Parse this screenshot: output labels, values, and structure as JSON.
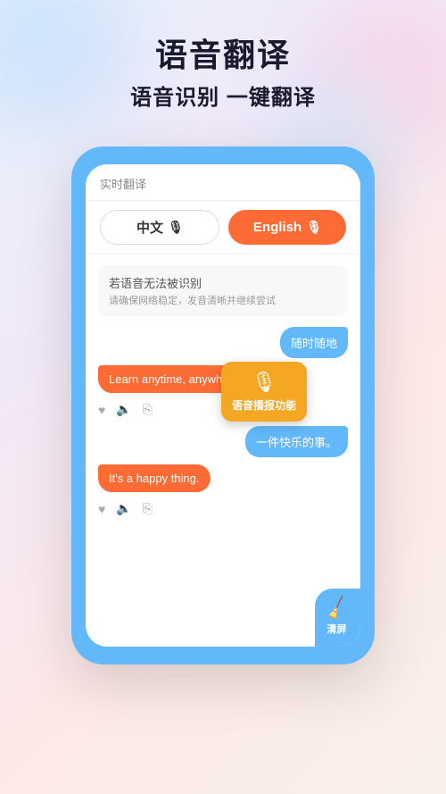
{
  "background": {
    "gradient": "linear-gradient(135deg, #e8f4fd, #f0e8f8, #fde8e8, #f8f0e8)"
  },
  "header": {
    "main_title": "语音翻译",
    "sub_title": "语音识别 一键翻译"
  },
  "phone": {
    "top_bar_label": "实时翻译",
    "lang_left": {
      "label": "中文",
      "mic": "🎤"
    },
    "lang_right": {
      "label": "English",
      "mic": "🎤"
    },
    "recognition_fail": {
      "title": "若语音无法被识别",
      "desc": "请确保网络稳定，发音清晰并继续尝试"
    },
    "chat": [
      {
        "type": "right",
        "text": "随时随地"
      },
      {
        "type": "left_red",
        "text": "Learn anytime, anywhere."
      },
      {
        "type": "right",
        "text": "一件快乐的事。"
      },
      {
        "type": "left_red",
        "text": "It's a happy thing."
      }
    ],
    "tooltip": {
      "text": "语音播报功能"
    },
    "clear_button": {
      "label": "清屏"
    }
  },
  "icons": {
    "mic": "🎙",
    "heart": "♥",
    "speaker": "🔈",
    "copy": "⎘",
    "broom": "🧹"
  }
}
